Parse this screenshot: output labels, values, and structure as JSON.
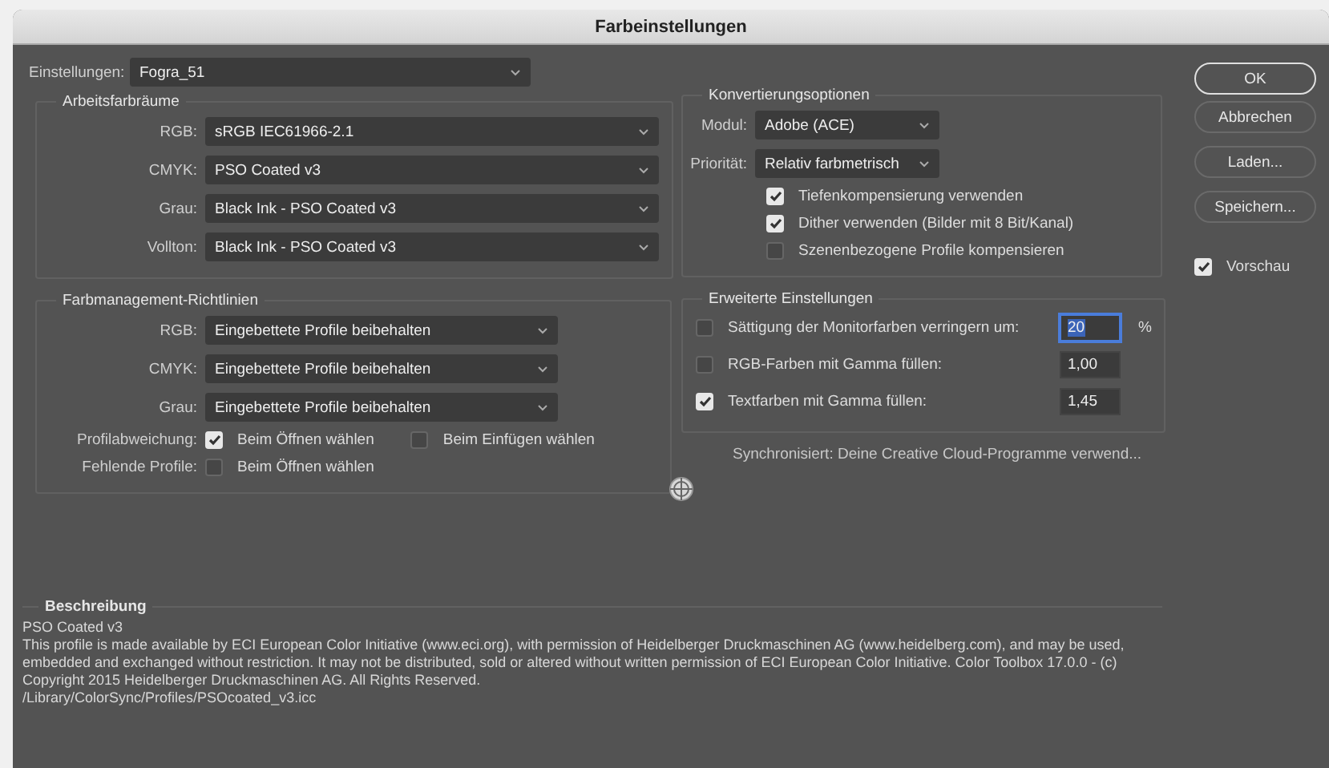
{
  "window": {
    "title": "Farbeinstellungen"
  },
  "settings": {
    "label": "Einstellungen:",
    "value": "Fogra_51"
  },
  "working_spaces": {
    "title": "Arbeitsfarbräume",
    "rows": [
      {
        "label": "RGB:",
        "value": "sRGB IEC61966-2.1"
      },
      {
        "label": "CMYK:",
        "value": "PSO Coated v3"
      },
      {
        "label": "Grau:",
        "value": "Black Ink - PSO Coated v3"
      },
      {
        "label": "Vollton:",
        "value": "Black Ink - PSO Coated v3"
      }
    ]
  },
  "policies": {
    "title": "Farbmanagement-Richtlinien",
    "rows": [
      {
        "label": "RGB:",
        "value": "Eingebettete Profile beibehalten"
      },
      {
        "label": "CMYK:",
        "value": "Eingebettete Profile beibehalten"
      },
      {
        "label": "Grau:",
        "value": "Eingebettete Profile beibehalten"
      }
    ],
    "checks": [
      {
        "label": "Profilabweichung:",
        "options": [
          {
            "label": "Beim Öffnen wählen",
            "checked": true
          },
          {
            "label": "Beim Einfügen wählen",
            "checked": false
          }
        ]
      },
      {
        "label": "Fehlende Profile:",
        "options": [
          {
            "label": "Beim Öffnen wählen",
            "checked": false
          }
        ]
      }
    ]
  },
  "conversion": {
    "title": "Konvertierungsoptionen",
    "selects": [
      {
        "label": "Modul:",
        "value": "Adobe (ACE)"
      },
      {
        "label": "Priorität:",
        "value": "Relativ farbmetrisch"
      }
    ],
    "options": [
      {
        "label": "Tiefenkompensierung verwenden",
        "checked": true
      },
      {
        "label": "Dither verwenden (Bilder mit 8 Bit/Kanal)",
        "checked": true
      },
      {
        "label": "Szenenbezogene Profile kompensieren",
        "checked": false
      }
    ]
  },
  "advanced": {
    "title": "Erweiterte Einstellungen",
    "rows": [
      {
        "label": "Sättigung der Monitorfarben verringern um:",
        "checked": false,
        "value": "20",
        "unit": "%",
        "focused": true
      },
      {
        "label": "RGB-Farben mit Gamma füllen:",
        "checked": false,
        "value": "1,00",
        "focused": false
      },
      {
        "label": "Textfarben mit Gamma füllen:",
        "checked": true,
        "value": "1,45",
        "focused": false
      }
    ]
  },
  "sync_message": "Synchronisiert: Deine Creative Cloud-Programme verwend...",
  "buttons": [
    {
      "label": "OK",
      "default": true
    },
    {
      "label": "Abbrechen",
      "default": false
    },
    {
      "label": "Laden...",
      "default": false
    },
    {
      "label": "Speichern...",
      "default": false
    }
  ],
  "preview": {
    "label": "Vorschau",
    "checked": true
  },
  "description": {
    "title": "Beschreibung",
    "profile": "PSO Coated v3",
    "text": "This profile is made available by ECI European Color Initiative (www.eci.org), with permission of Heidelberger Druckmaschinen AG (www.heidelberg.com), and may be used, embedded and exchanged without restriction. It may not be distributed, sold or altered without written permission of ECI European Color Initiative. Color Toolbox 17.0.0 - (c) Copyright 2015 Heidelberger Druckmaschinen AG. All Rights Reserved.",
    "path": "/Library/ColorSync/Profiles/PSOcoated_v3.icc"
  }
}
